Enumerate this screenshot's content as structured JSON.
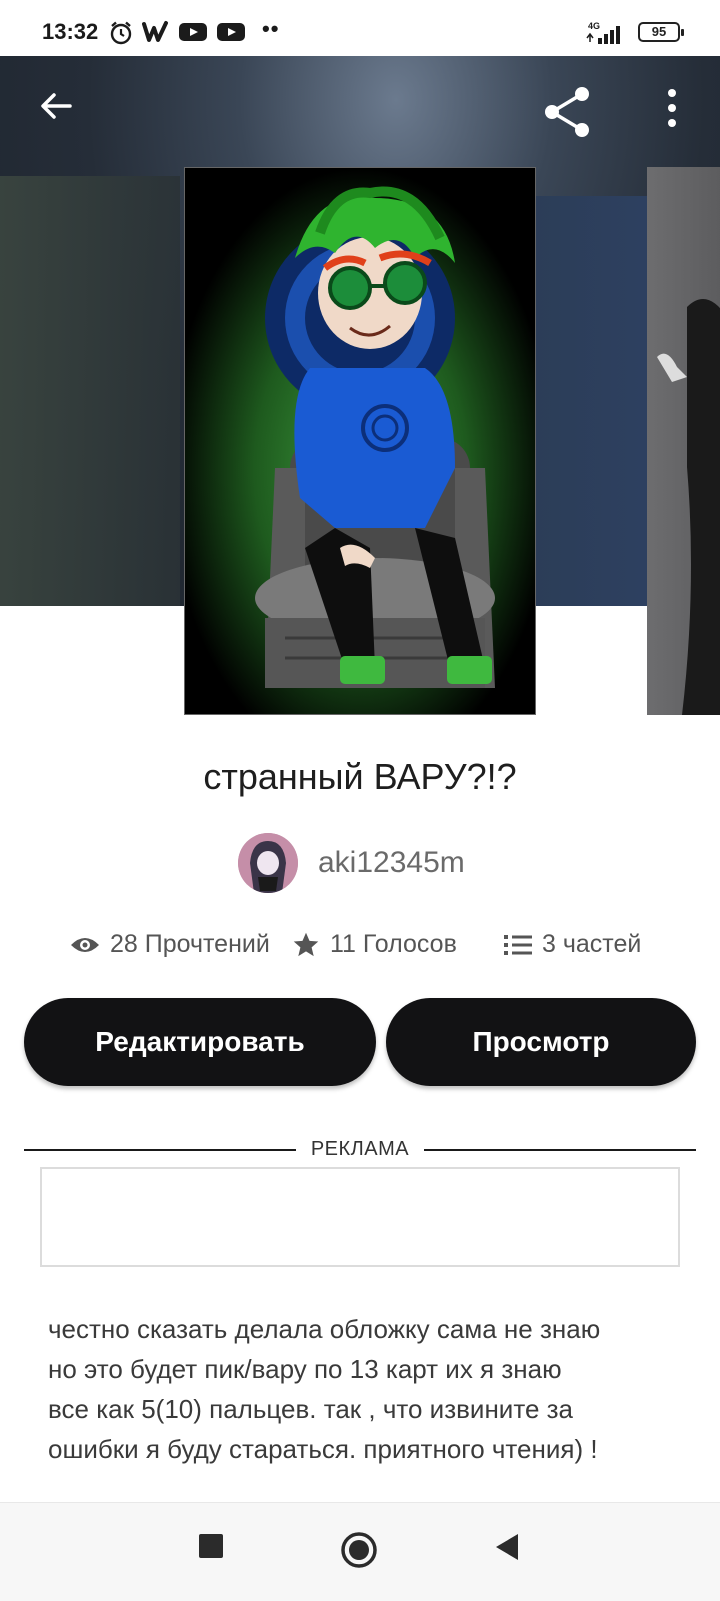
{
  "status_bar": {
    "time": "13:32",
    "network": "4G",
    "battery": "95",
    "icons": [
      "alarm-icon",
      "wattpad-icon",
      "youtube-icon",
      "youtube-icon",
      "more-dots-icon",
      "signal-icon",
      "battery-icon"
    ]
  },
  "top_bar": {
    "back_icon": "arrow-left-icon",
    "share_icon": "share-icon",
    "menu_icon": "more-vertical-icon"
  },
  "story": {
    "title": "странный ВАРУ?!?",
    "author": "aki12345m",
    "stats": {
      "reads": "28 Прочтений",
      "votes": "11 Голосов",
      "parts": "3 частей"
    }
  },
  "actions": {
    "edit_label": "Редактировать",
    "view_label": "Просмотр"
  },
  "ad": {
    "label": "РЕКЛАМА"
  },
  "description": {
    "line1": "честно сказать делала обложку сама не знаю",
    "line2": "но это будет пик/вару по 13 карт их я знаю",
    "line3": "все как 5(10) пальцев. так , что извините за",
    "line4": "ошибки я буду стараться. приятного чтения) !"
  },
  "nav_bar": {
    "icons": [
      "recent-apps-icon",
      "home-icon",
      "back-icon"
    ]
  },
  "colors": {
    "button_bg": "#121214",
    "button_text": "#ffffff",
    "hero_bg": "#252d38"
  }
}
